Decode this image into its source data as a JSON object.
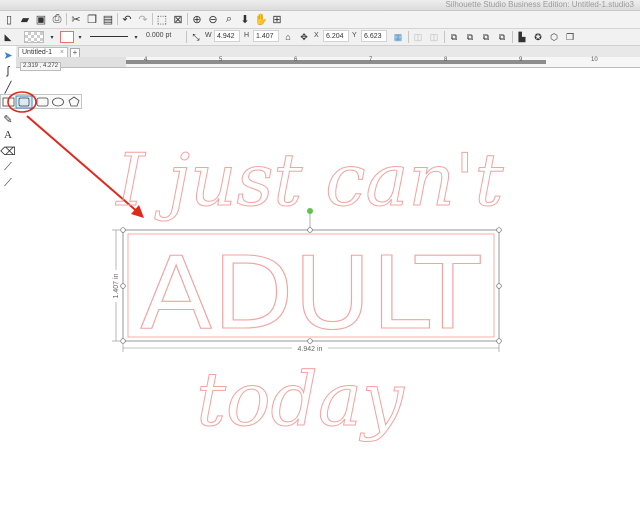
{
  "window": {
    "title": "Silhouette Studio Business Edition: Untitled-1.studio3"
  },
  "toolbar": {
    "line_weight": "0.000 pt",
    "w_label": "W",
    "w_value": "4.942",
    "h_label": "H",
    "h_value": "1.407",
    "x_label": "X",
    "x_value": "6.204",
    "y_label": "Y",
    "y_value": "6.623"
  },
  "tabs": [
    {
      "label": "Untitled-1",
      "close": "×"
    }
  ],
  "tab_add": "+",
  "ruler": {
    "numbers": [
      "4",
      "5",
      "6",
      "7",
      "8",
      "9",
      "10"
    ]
  },
  "coords": "2.319 , 4.272",
  "tools": {
    "text_tool": "A"
  },
  "design": {
    "line1": "I just can't",
    "word": "ADULT",
    "line3": "today",
    "width_dim": "4.942 in",
    "height_dim": "1.407 in",
    "line_color": "#f4a3a1",
    "selection_color": "#7d7d7d",
    "handle_rotate_color": "#5fc24b"
  },
  "annotation": {
    "color": "#e0281b"
  }
}
